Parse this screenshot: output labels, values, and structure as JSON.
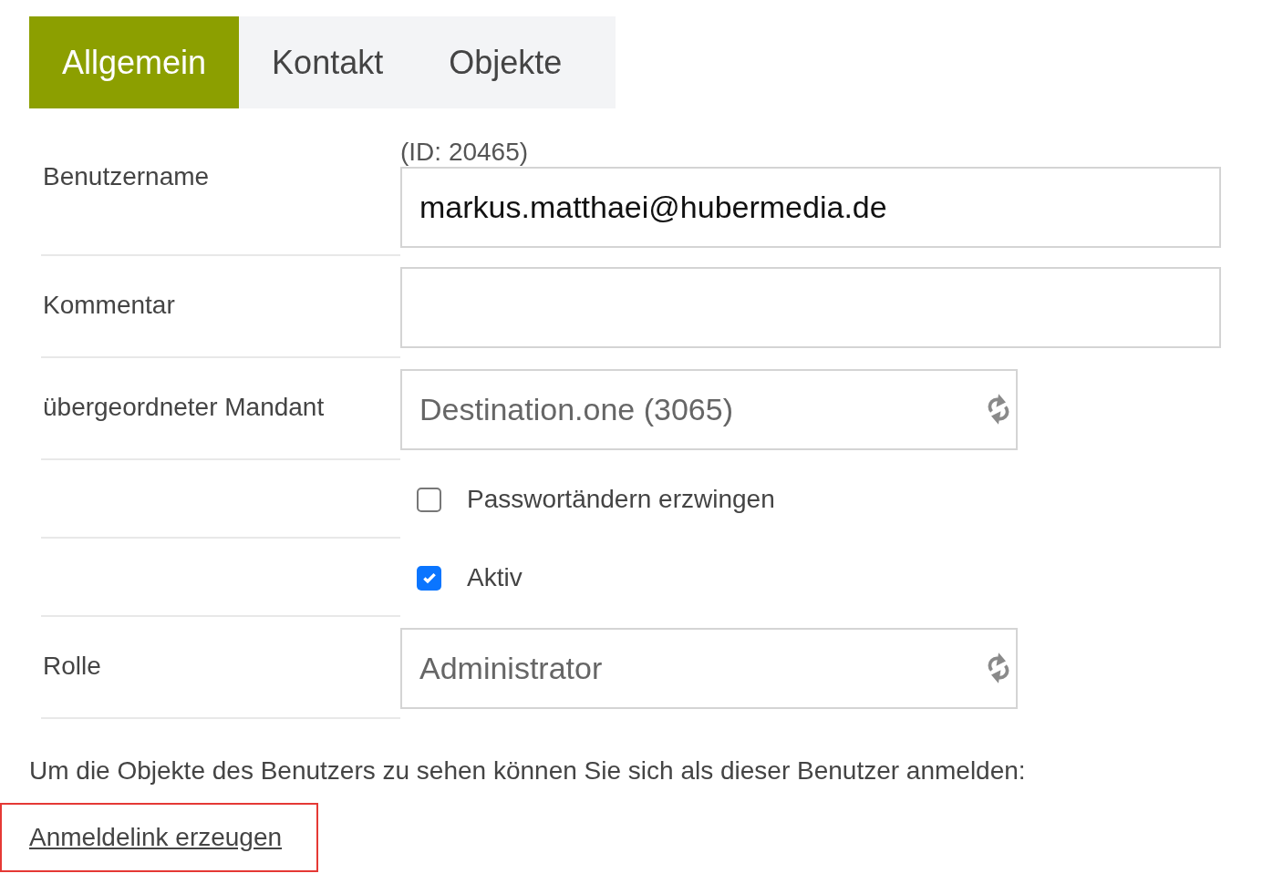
{
  "tabs": [
    {
      "label": "Allgemein",
      "selected": true
    },
    {
      "label": "Kontakt",
      "selected": false
    },
    {
      "label": "Objekte",
      "selected": false
    }
  ],
  "rows": [
    {
      "kind": "text",
      "label": "Benutzername",
      "note": "(ID: 20465)",
      "value": "markus.matthaei@hubermedia.de"
    },
    {
      "kind": "text",
      "label": "Kommentar"
    },
    {
      "kind": "select",
      "label": "übergeordneter Mandant",
      "value": "Destination.one (3065)"
    },
    {
      "kind": "checkbox",
      "text": "Passwortändern erzwingen",
      "checked": false
    },
    {
      "kind": "checkbox",
      "text": "Aktiv",
      "checked": true
    },
    {
      "kind": "select",
      "label": "Rolle",
      "value": "Administrator"
    }
  ],
  "hint": "Um die Objekte des Benutzers zu sehen können Sie sich als dieser Benutzer anmelden:",
  "link": {
    "label": "Anmeldelink erzeugen",
    "highlighted": true
  }
}
